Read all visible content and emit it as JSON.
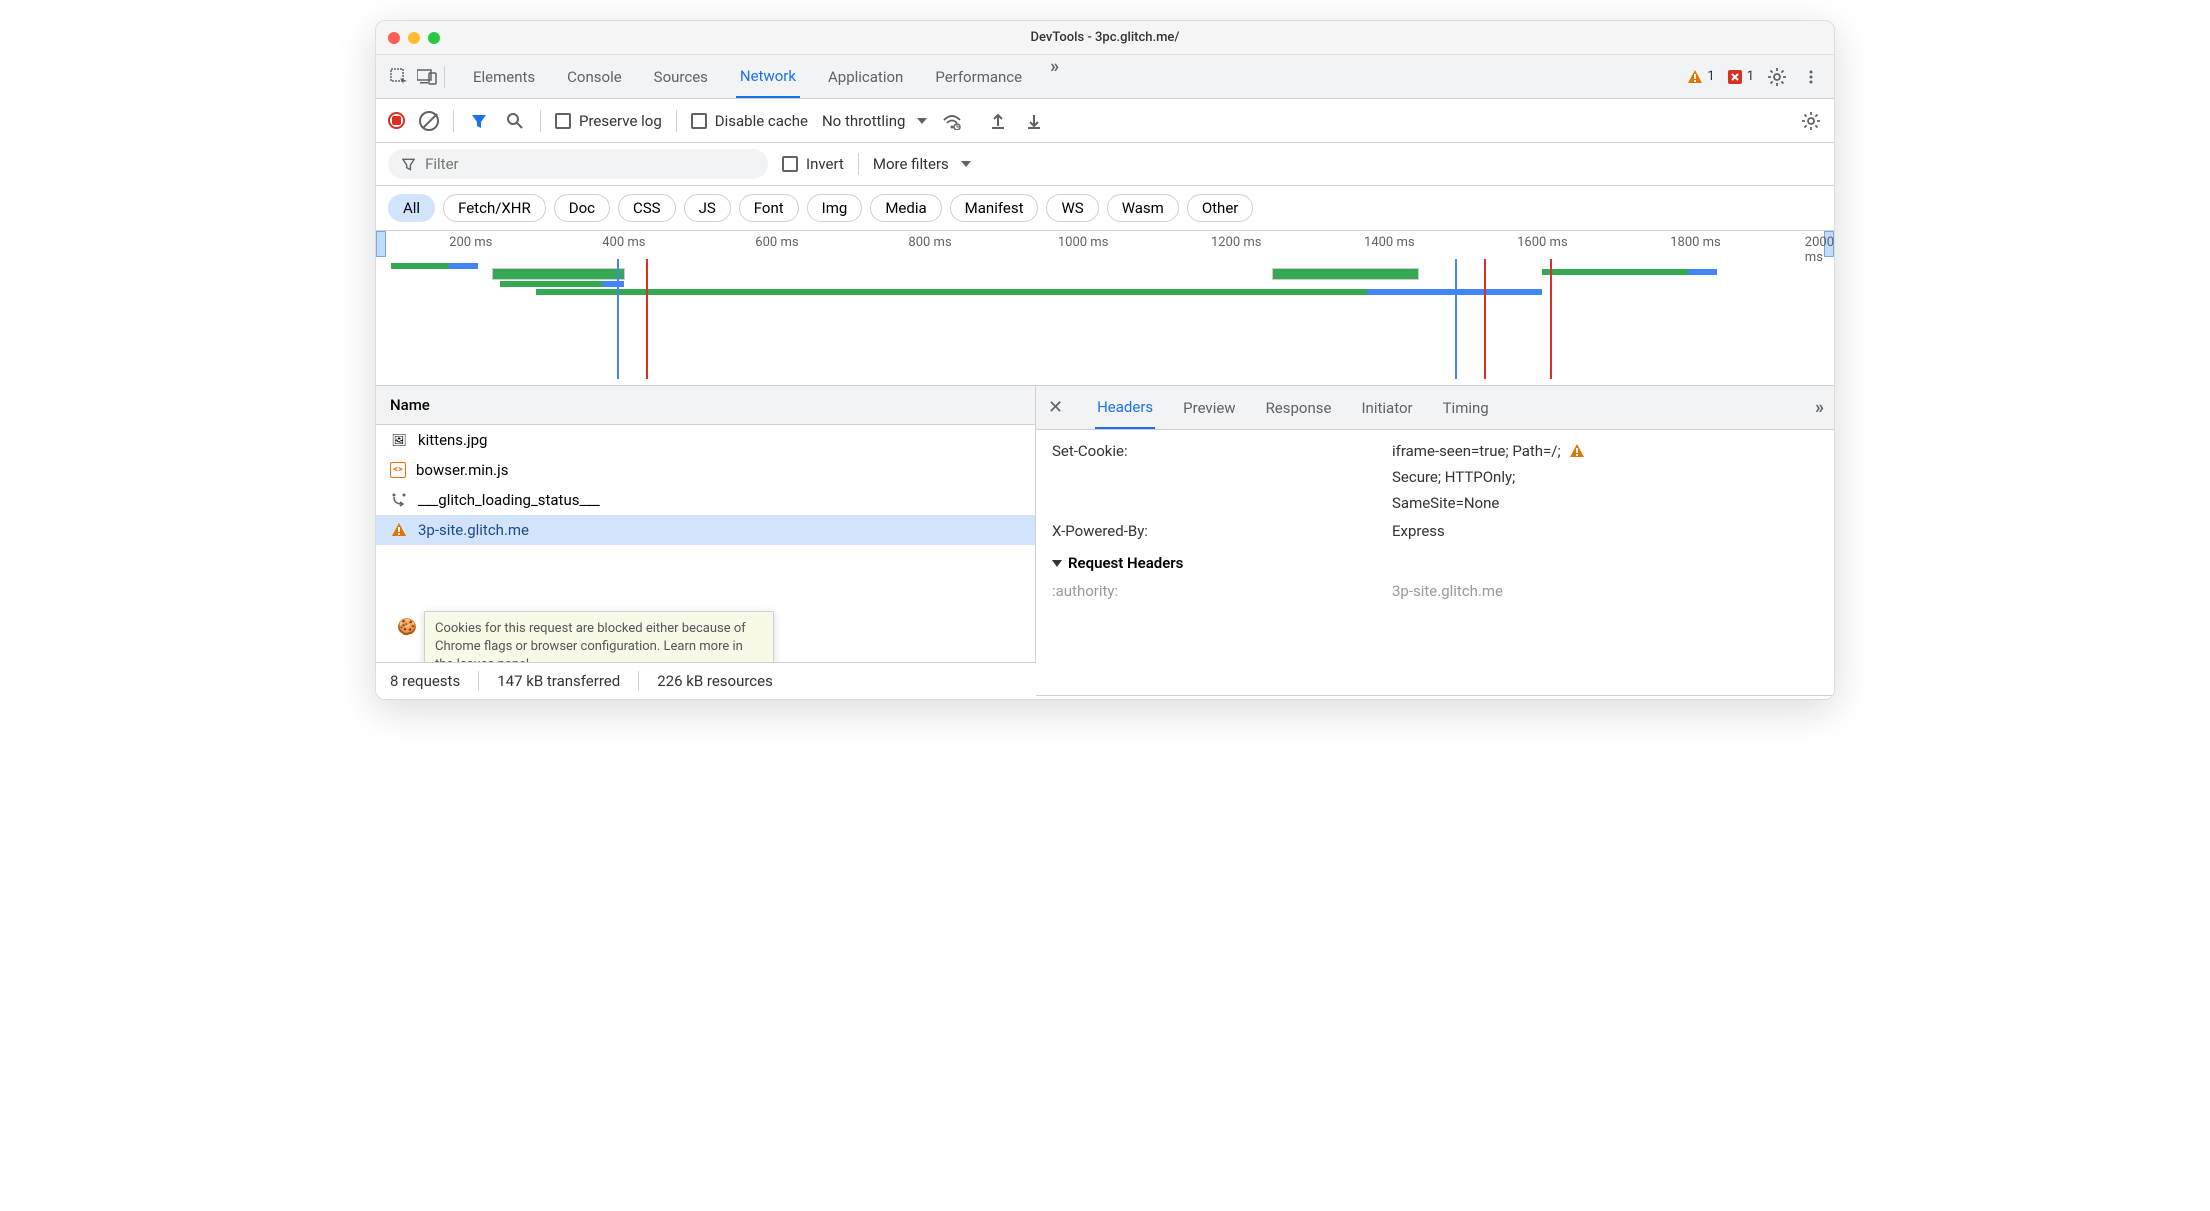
{
  "window": {
    "title": "DevTools - 3pc.glitch.me/"
  },
  "mainTabs": [
    "Elements",
    "Console",
    "Sources",
    "Network",
    "Application",
    "Performance"
  ],
  "mainTabActive": "Network",
  "toolbarRight": {
    "warnCount": "1",
    "errCount": "1"
  },
  "networkBar": {
    "preserveLog": "Preserve log",
    "disableCache": "Disable cache",
    "throttling": "No throttling"
  },
  "filterRow": {
    "placeholder": "Filter",
    "invert": "Invert",
    "moreFilters": "More filters"
  },
  "typeFilters": [
    "All",
    "Fetch/XHR",
    "Doc",
    "CSS",
    "JS",
    "Font",
    "Img",
    "Media",
    "Manifest",
    "WS",
    "Wasm",
    "Other"
  ],
  "typeFilterActive": "All",
  "timeline": {
    "labels": [
      "200 ms",
      "400 ms",
      "600 ms",
      "800 ms",
      "1000 ms",
      "1200 ms",
      "1400 ms",
      "1600 ms",
      "1800 ms",
      "2000 ms"
    ]
  },
  "leftPanel": {
    "header": "Name",
    "rows": [
      {
        "icon": "img",
        "name": "kittens.jpg"
      },
      {
        "icon": "js",
        "name": "bowser.min.js"
      },
      {
        "icon": "redirect",
        "name": "___glitch_loading_status___"
      },
      {
        "icon": "warn",
        "name": "3p-site.glitch.me",
        "selected": true
      }
    ],
    "tooltip": "Cookies for this request are blocked either because of Chrome flags or browser configuration. Learn more in the Issues panel."
  },
  "rightPanel": {
    "tabs": [
      "Headers",
      "Preview",
      "Response",
      "Initiator",
      "Timing"
    ],
    "activeTab": "Headers",
    "headers": [
      {
        "name": "Set-Cookie:",
        "lines": [
          "iframe-seen=true; Path=/;",
          "Secure; HTTPOnly;",
          "SameSite=None"
        ],
        "warn": true
      },
      {
        "name": "X-Powered-By:",
        "lines": [
          "Express"
        ]
      }
    ],
    "requestHeadersTitle": "Request Headers",
    "reqHeaderName": ":authority:",
    "reqHeaderValue": "3p-site.glitch.me"
  },
  "statusBar": {
    "requests": "8 requests",
    "transferred": "147 kB transferred",
    "resources": "226 kB resources"
  }
}
